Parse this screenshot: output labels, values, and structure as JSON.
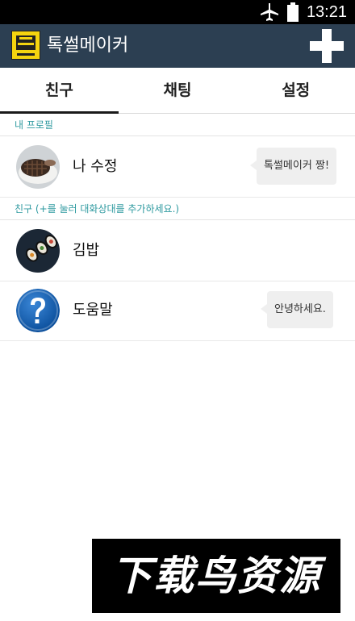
{
  "status_bar": {
    "time": "13:21",
    "icons": [
      "airplane-mode-icon",
      "battery-icon"
    ]
  },
  "app_bar": {
    "title": "톡썰메이커",
    "logo_lines": [
      "톡썰",
      "메이커",
      "채팅수정"
    ],
    "add_icon": "plus-icon"
  },
  "tabs": [
    {
      "label": "친구",
      "active": true
    },
    {
      "label": "채팅",
      "active": false
    },
    {
      "label": "설정",
      "active": false
    }
  ],
  "my_profile": {
    "section_label": "내 프로필",
    "name": "나 수정",
    "status_message": "톡썰메이커 짱!"
  },
  "friends": {
    "section_label": "친구 (+를 눌러 대화상대를 추가하세요.)",
    "items": [
      {
        "name": "김밥",
        "status_message": ""
      },
      {
        "name": "도움말",
        "status_message": "안녕하세요."
      }
    ]
  },
  "watermark": {
    "text": "下载鸟资源"
  },
  "colors": {
    "app_bar": "#2c3f52",
    "accent": "#2f9aa0",
    "logo": "#f5d40f"
  }
}
